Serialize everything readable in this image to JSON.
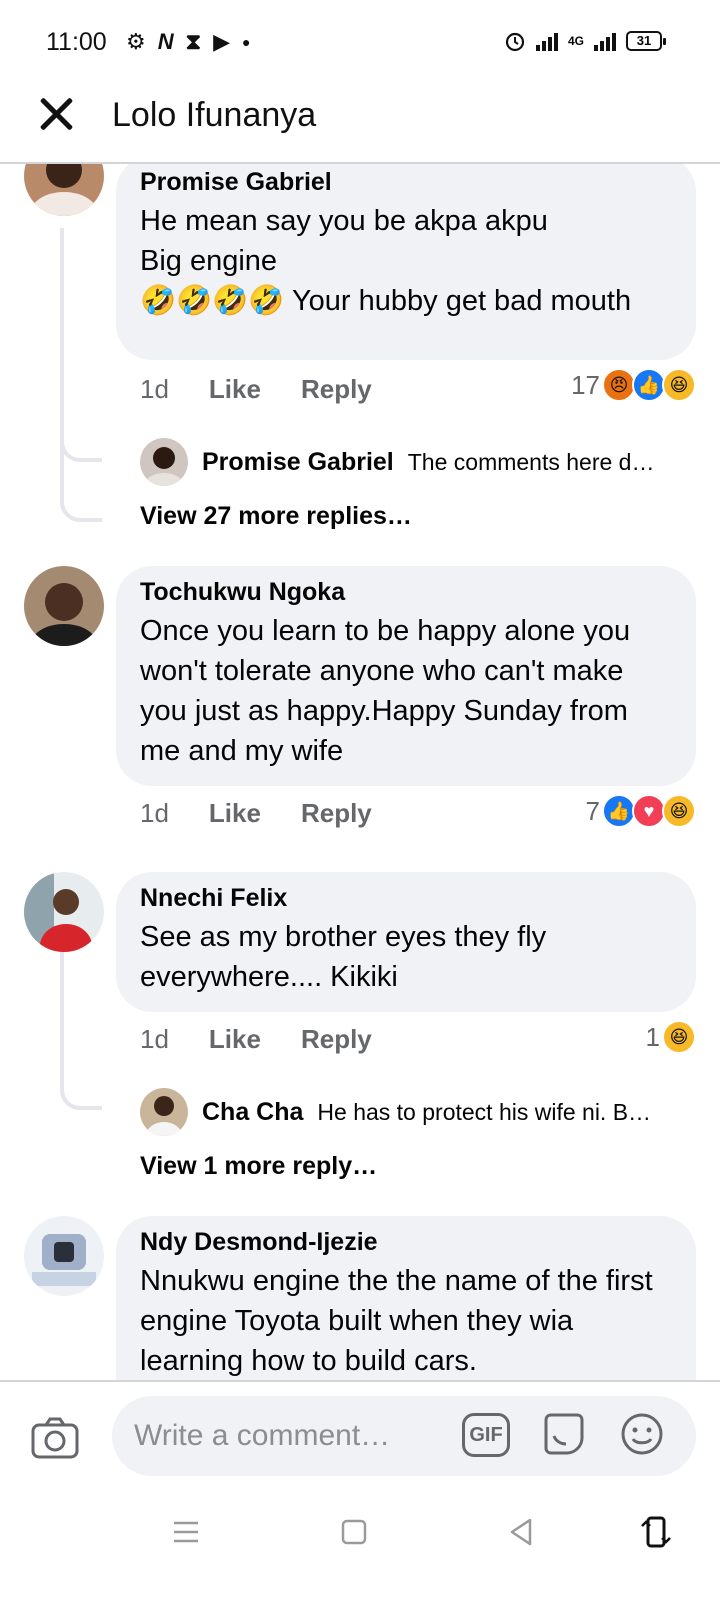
{
  "status_bar": {
    "time": "11:00",
    "network": "4G",
    "battery": "31"
  },
  "header": {
    "title": "Lolo Ifunanya"
  },
  "comments": [
    {
      "author": "Promise Gabriel",
      "text": "He mean say you be akpa akpu\nBig engine\n🤣🤣🤣🤣 Your hubby get bad mouth",
      "time": "1d",
      "like_label": "Like",
      "reply_label": "Reply",
      "reaction_count": "17",
      "reactions": [
        "angry",
        "like",
        "haha"
      ],
      "reply_preview": {
        "author": "Promise Gabriel",
        "text": "The comments here d…"
      },
      "view_more": "View 27 more replies…"
    },
    {
      "author": "Tochukwu Ngoka",
      "text": "Once you learn to be happy alone you won't tolerate anyone who can't make you just as happy.Happy Sunday from me and my wife",
      "time": "1d",
      "like_label": "Like",
      "reply_label": "Reply",
      "reaction_count": "7",
      "reactions": [
        "like",
        "love",
        "haha"
      ]
    },
    {
      "author": "Nnechi Felix",
      "text": "See as my brother eyes they fly everywhere.... Kikiki",
      "time": "1d",
      "like_label": "Like",
      "reply_label": "Reply",
      "reaction_count": "1",
      "reactions": [
        "haha"
      ],
      "reply_preview": {
        "author": "Cha Cha",
        "text": "He has to protect his wife ni. B…"
      },
      "view_more": "View 1 more reply…"
    },
    {
      "author": "Ndy Desmond-Ijezie",
      "text": "Nnukwu engine the the name of the first engine Toyota built when they wia learning how to build cars."
    }
  ],
  "composer": {
    "placeholder": "Write a comment…",
    "gif_label": "GIF"
  },
  "colors": {
    "bubble": "#f0f2f5",
    "secondary_text": "#65676b",
    "like_blue": "#1877f2",
    "love_red": "#f33e58",
    "haha_yellow": "#f7b928",
    "angry_orange": "#e9710f"
  }
}
